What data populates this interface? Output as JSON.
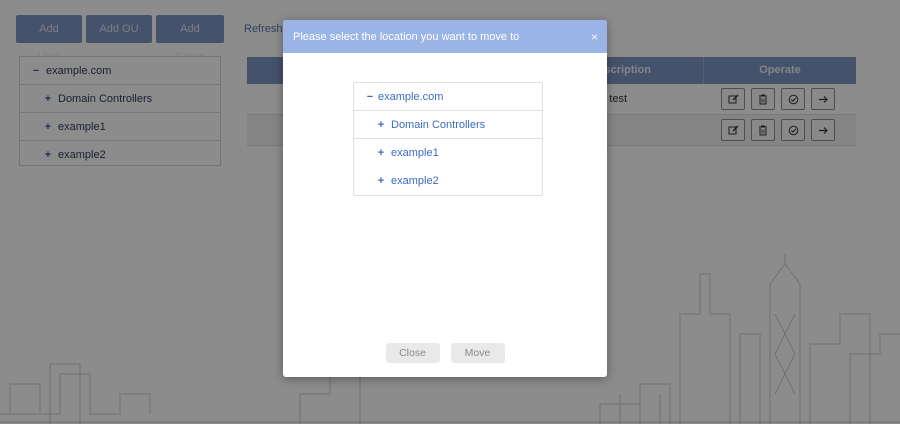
{
  "toolbar": {
    "buttons": [
      "Add User",
      "Add OU",
      "Add Group"
    ],
    "refresh_label": "Refresh"
  },
  "tree": {
    "root": "example.com",
    "children": [
      "Domain Controllers",
      "example1",
      "example2"
    ]
  },
  "table": {
    "col_description": "Description",
    "col_operate": "Operate",
    "rows": [
      {
        "description": "test"
      },
      {
        "description": ""
      }
    ]
  },
  "modal": {
    "title": "Please select the location you want to move to",
    "close_icon": "×",
    "tree": {
      "root": "example.com",
      "children": [
        "Domain Controllers",
        "example1",
        "example2"
      ]
    },
    "close_label": "Close",
    "move_label": "Move"
  },
  "icons": {
    "edit": "edit-icon",
    "delete": "trash-icon",
    "enable": "check-circle-icon",
    "move": "arrow-right-icon",
    "expand": "plus-icon",
    "collapse": "minus-icon"
  },
  "colors": {
    "accent": "#7f96c3",
    "modal_header": "#9ab4e6",
    "link": "#3c6bc2"
  }
}
